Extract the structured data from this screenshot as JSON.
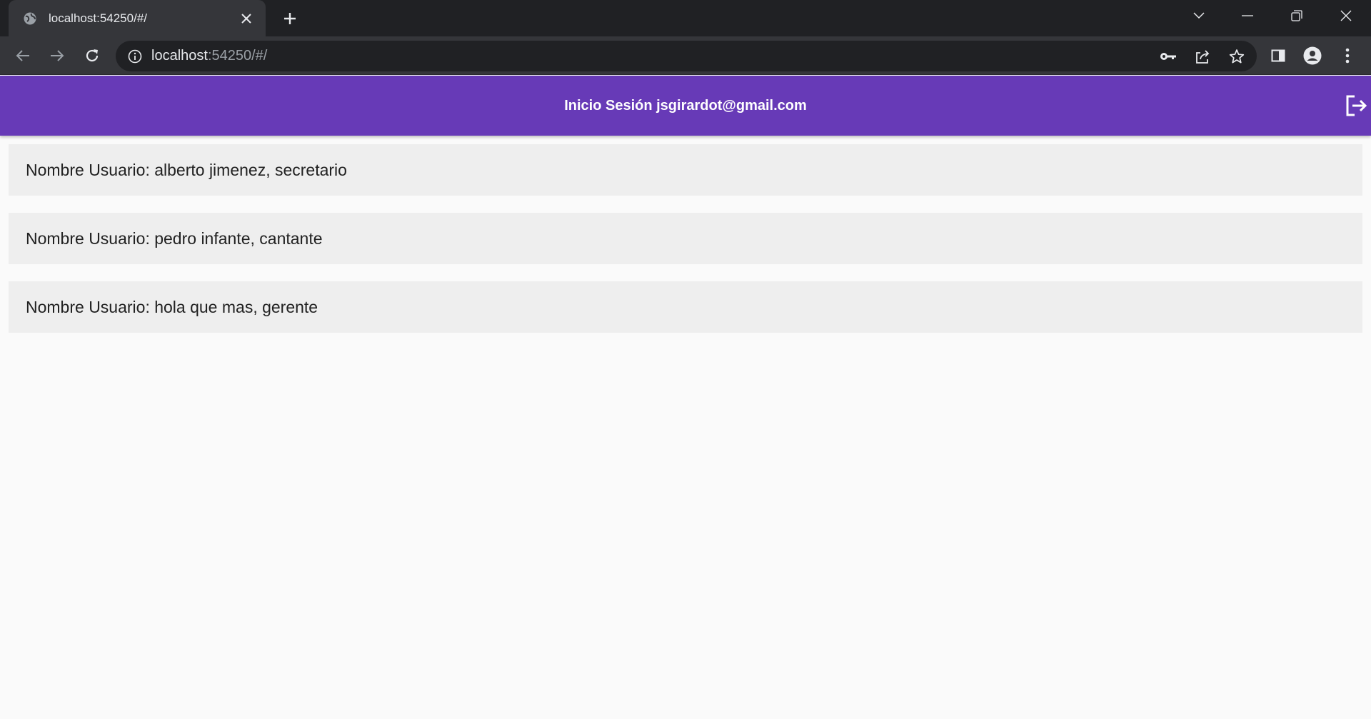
{
  "browser": {
    "tab": {
      "title": "localhost:54250/#/"
    },
    "url": {
      "host": "localhost",
      "rest": ":54250/#/"
    }
  },
  "app": {
    "colors": {
      "appbar": "#673ab7",
      "row": "#eeeeee",
      "background": "#fafafa"
    },
    "title": "Inicio Sesión jsgirardot@gmail.com",
    "users": [
      {
        "label": "Nombre Usuario: alberto jimenez, secretario"
      },
      {
        "label": "Nombre Usuario: pedro infante, cantante"
      },
      {
        "label": "Nombre Usuario: hola que mas, gerente"
      }
    ]
  },
  "icons": [
    "globe-icon",
    "close-icon",
    "plus-icon",
    "chevron-down-icon",
    "minimize-icon",
    "restore-icon",
    "close-window-icon",
    "back-arrow-icon",
    "forward-arrow-icon",
    "reload-icon",
    "info-icon",
    "key-icon",
    "share-icon",
    "star-icon",
    "sidebar-icon",
    "profile-icon",
    "more-vert-icon",
    "logout-icon"
  ]
}
